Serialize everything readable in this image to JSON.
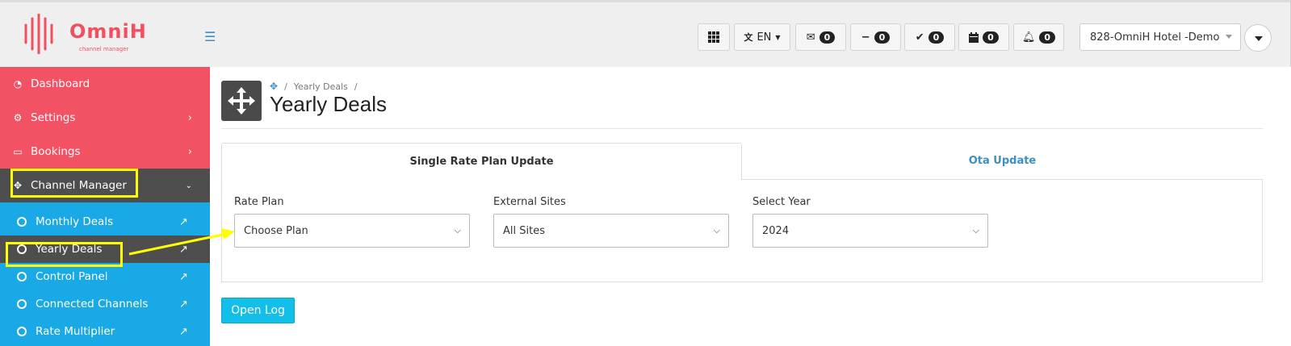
{
  "brand": {
    "name": "OmniH",
    "tagline": "channel manager",
    "color": "#f0505f"
  },
  "topbar": {
    "language": "EN",
    "counters": [
      {
        "icon": "envelope-open-icon",
        "value": "0"
      },
      {
        "icon": "minus-icon",
        "value": "0"
      },
      {
        "icon": "check-icon",
        "value": "0"
      },
      {
        "icon": "calendar-icon",
        "value": "0"
      },
      {
        "icon": "bell-icon",
        "value": "0"
      }
    ],
    "hotel": "828-OmniH Hotel -Demo"
  },
  "sidebar": {
    "items": [
      {
        "label": "Dashboard",
        "icon": "tachometer-icon"
      },
      {
        "label": "Settings",
        "icon": "gear-icon"
      },
      {
        "label": "Bookings",
        "icon": "ticket-icon"
      },
      {
        "label": "Channel Manager",
        "icon": "arrows-move-icon"
      }
    ],
    "subitems": [
      {
        "label": "Monthly Deals"
      },
      {
        "label": "Yearly Deals"
      },
      {
        "label": "Control Panel"
      },
      {
        "label": "Connected Channels"
      },
      {
        "label": "Rate Multiplier"
      }
    ]
  },
  "page": {
    "breadcrumb": "Yearly Deals",
    "title": "Yearly Deals"
  },
  "tabs": [
    {
      "label": "Single Rate Plan Update",
      "active": true
    },
    {
      "label": "Ota Update",
      "active": false
    }
  ],
  "form": {
    "rate_plan": {
      "label": "Rate Plan",
      "value": "Choose Plan"
    },
    "external_sites": {
      "label": "External Sites",
      "value": "All Sites"
    },
    "select_year": {
      "label": "Select Year",
      "value": "2024"
    }
  },
  "open_log": "Open Log",
  "colors": {
    "sidebar_top": "#f25264",
    "sidebar_bottom": "#18a9e6",
    "active": "#4e4e4e",
    "highlight": "#ffff00",
    "button": "#11bfe8"
  }
}
